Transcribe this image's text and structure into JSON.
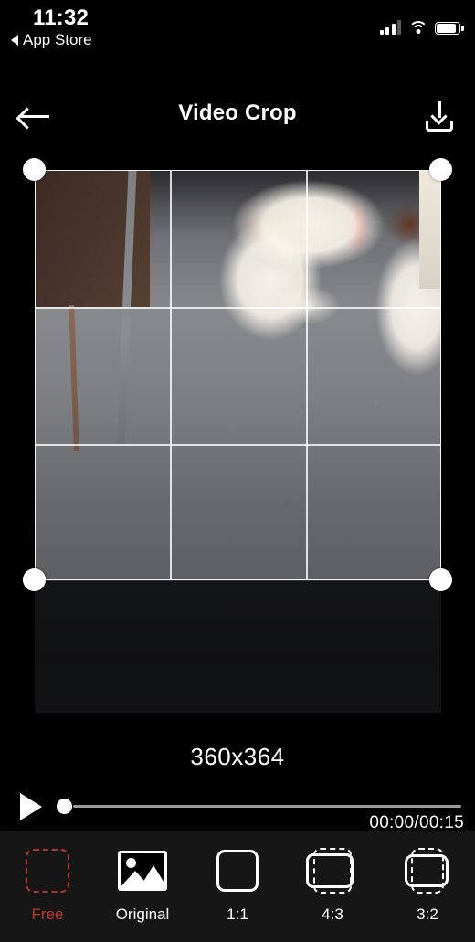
{
  "status_bar": {
    "time": "11:32",
    "return_label": "App Store",
    "icons": {
      "back_triangle": "triangle-left-icon",
      "signal": "cellular-signal-icon",
      "wifi": "wifi-icon",
      "battery": "battery-full-icon"
    }
  },
  "header": {
    "back_icon": "arrow-left-icon",
    "title": "Video Crop",
    "export_icon": "download-icon"
  },
  "editor": {
    "crop_handles": [
      "top-left",
      "top-right",
      "bottom-left",
      "bottom-right"
    ],
    "grid": "rule-of-thirds",
    "dimensions_label": "360x364"
  },
  "playback": {
    "play_icon": "play-icon",
    "progress_percent": 0,
    "time_label": "00:00/00:15"
  },
  "toolbar": {
    "selected_index": 0,
    "selected_color": "#c0392b",
    "options": [
      {
        "label": "Free",
        "icon": "dashed-square-icon"
      },
      {
        "label": "Original",
        "icon": "photo-icon"
      },
      {
        "label": "1:1",
        "icon": "square-icon"
      },
      {
        "label": "4:3",
        "icon": "rect-4-3-icon"
      },
      {
        "label": "3:2",
        "icon": "rect-3-2-icon"
      }
    ]
  }
}
